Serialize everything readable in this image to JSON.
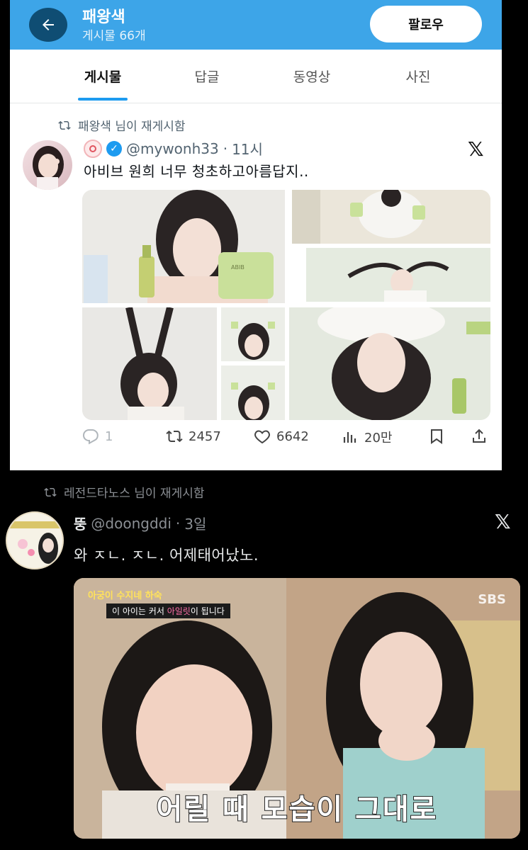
{
  "profile_header": {
    "name": "패왕색",
    "post_count": "게시물 66개",
    "follow_label": "팔로우"
  },
  "tabs": [
    {
      "label": "게시물",
      "active": true
    },
    {
      "label": "답글",
      "active": false
    },
    {
      "label": "동영상",
      "active": false
    },
    {
      "label": "사진",
      "active": false
    }
  ],
  "tweet1": {
    "retweeted_by": "패왕색 님이 재게시함",
    "handle": "@mywonh33",
    "separator": "·",
    "time": "11시",
    "text": "아비브 원희  너무 청초하고아름답지..",
    "stats": {
      "replies": "1",
      "retweets": "2457",
      "likes": "6642",
      "views": "20만"
    },
    "photo_label": "ABIB"
  },
  "tweet2": {
    "retweeted_by": "레전드타노스 님이 재게시함",
    "name": "뚱",
    "handle": "@doongddi",
    "separator": "·",
    "time": "3일",
    "text": "와 ㅈㄴ.  ㅈㄴ. 어제태어났노.",
    "video": {
      "broadcaster": "SBS",
      "show_title": "아궁이 수지네 하숙",
      "show_subtitle_a": "이 아이는 커서 ",
      "show_subtitle_hl": "아일릿",
      "show_subtitle_b": "이 됩니다",
      "caption": "어릴 때 모습이 그대로"
    }
  },
  "colors": {
    "header_blue": "#3da5e8",
    "accent": "#1d9bf0",
    "verified": "#1d9bf0",
    "dark_bg": "#000000"
  }
}
